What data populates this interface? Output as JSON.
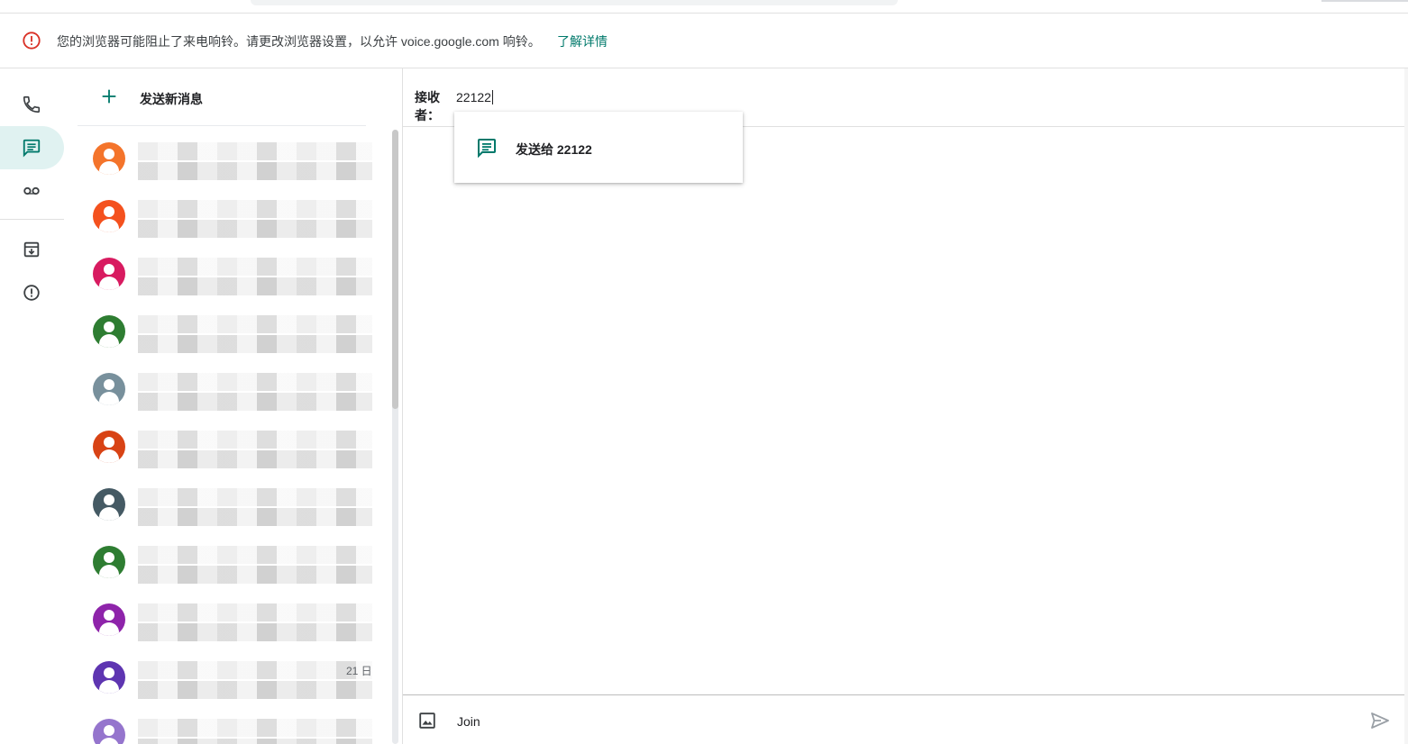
{
  "banner": {
    "message": "您的浏览器可能阻止了来电响铃。请更改浏览器设置，以允许 voice.google.com 响铃。",
    "learn_more": "了解详情"
  },
  "rail": {
    "items": [
      {
        "icon": "phone-icon"
      },
      {
        "icon": "message-icon",
        "active": true
      },
      {
        "icon": "voicemail-icon"
      },
      {
        "icon": "archive-icon"
      },
      {
        "icon": "spam-icon"
      }
    ]
  },
  "list": {
    "new_message_label": "发送新消息",
    "conversations": [
      {
        "avatar_color": "#f4742b"
      },
      {
        "avatar_color": "#f4511e"
      },
      {
        "avatar_color": "#d81b60"
      },
      {
        "avatar_color": "#2e7d32"
      },
      {
        "avatar_color": "#78909c"
      },
      {
        "avatar_color": "#d84315"
      },
      {
        "avatar_color": "#455a64"
      },
      {
        "avatar_color": "#2e7d32"
      },
      {
        "avatar_color": "#8e24aa"
      },
      {
        "avatar_color": "#5e35b1",
        "date": "21 日"
      },
      {
        "avatar_color": "#9575cd"
      }
    ]
  },
  "compose": {
    "to_label": "接收者：",
    "to_value": "22122",
    "suggestion": "发送给 22122",
    "message_value": "Join"
  },
  "colors": {
    "accent": "#00796b",
    "warning": "#d93025"
  }
}
